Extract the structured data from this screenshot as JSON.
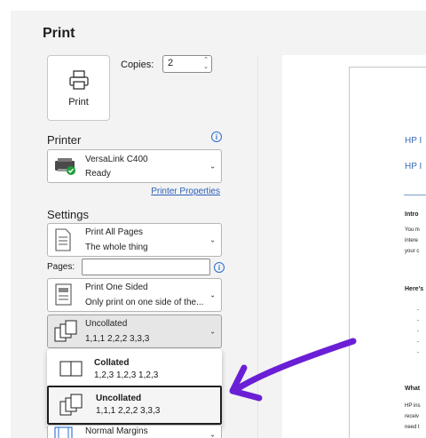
{
  "title": "Print",
  "print_button": {
    "label": "Print",
    "icon": "printer-icon"
  },
  "copies": {
    "label": "Copies:",
    "value": "2"
  },
  "printer": {
    "header": "Printer",
    "name": "VersaLink C400",
    "status": "Ready",
    "properties_link": "Printer Properties"
  },
  "settings": {
    "header": "Settings",
    "print_range": {
      "line1": "Print All Pages",
      "line2": "The whole thing"
    },
    "pages_label": "Pages:",
    "pages_value": "",
    "sides": {
      "line1": "Print One Sided",
      "line2": "Only print on one side of the..."
    },
    "collation": {
      "line1": "Uncollated",
      "line2": "1,1,1   2,2,2   3,3,3"
    },
    "margins": {
      "line1": "Normal Margins"
    }
  },
  "collation_menu": [
    {
      "line1": "Collated",
      "line2": "1,2,3   1,2,3   1,2,3"
    },
    {
      "line1": "Uncollated",
      "line2": "1,1,1   2,2,2   3,3,3"
    }
  ],
  "preview": {
    "heading1": "HP I",
    "heading2": "HP I",
    "intro": "Intro",
    "body1": "You m",
    "body2": "intere",
    "body3": "your c",
    "heres": "Here's",
    "bullets": [
      "-",
      "-",
      "-",
      "-",
      "-"
    ],
    "what": "What",
    "body4": "HP ins",
    "body5": "receiv",
    "body6": "need t"
  },
  "colors": {
    "accent": "#2b6cd0",
    "annotation_arrow": "#6a1fd6"
  }
}
